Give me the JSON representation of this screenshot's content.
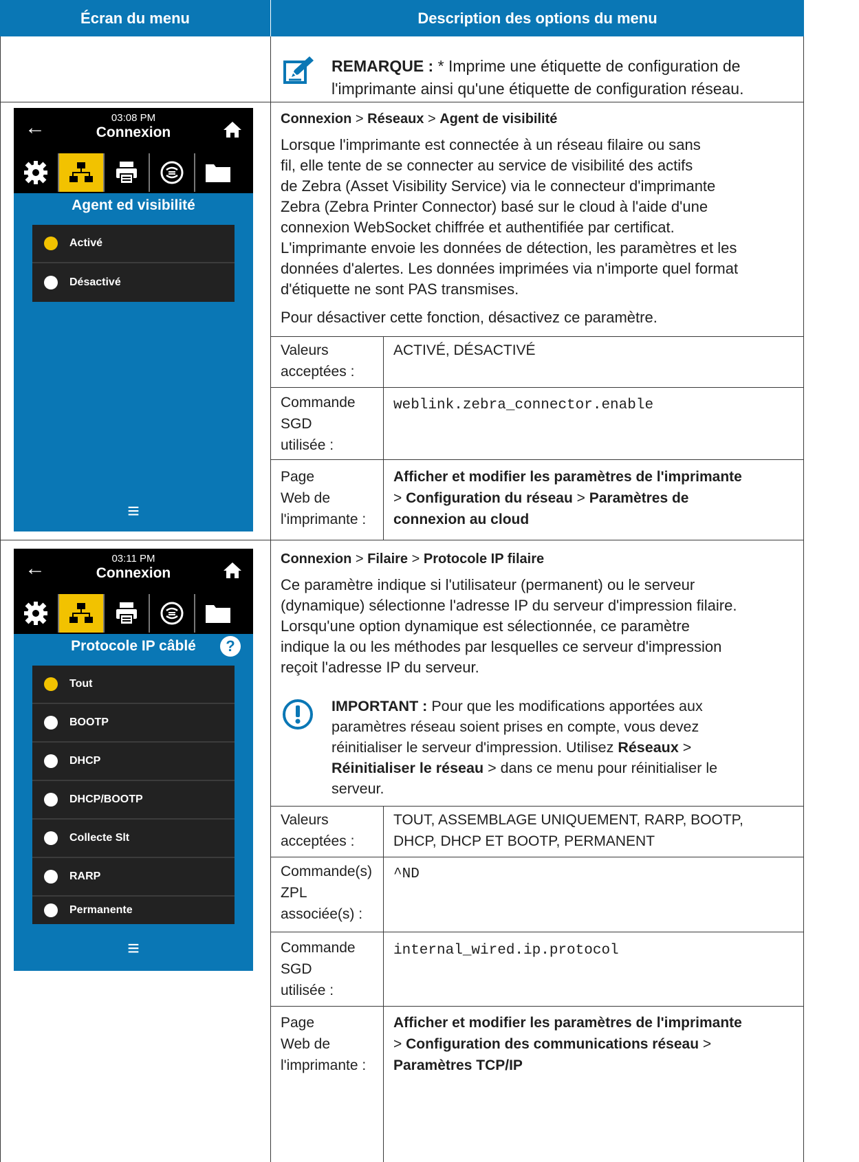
{
  "header": {
    "col1": "Écran du menu",
    "col2": "Description des options du menu"
  },
  "note": {
    "label": "REMARQUE :",
    "text_line1": " * Imprime une étiquette de configuration de",
    "text_line2": "l'imprimante ainsi qu'une étiquette de configuration réseau."
  },
  "section1": {
    "screen": {
      "time": "03:08 PM",
      "title": "Connexion",
      "heading": "Agent ed visibilité",
      "options": [
        {
          "label": "Activé",
          "selected": true
        },
        {
          "label": "Désactivé",
          "selected": false
        }
      ]
    },
    "breadcrumb": {
      "a": "Connexion",
      "sep1": " > ",
      "b": "Réseaux",
      "sep2": " > ",
      "c": "Agent de visibilité"
    },
    "para1": [
      "Lorsque l'imprimante est connectée à un réseau filaire ou sans",
      "fil, elle tente de se connecter au service de visibilité des actifs",
      "de Zebra (Asset Visibility Service) via le connecteur d'imprimante",
      "Zebra (Zebra Printer Connector) basé sur le cloud à l'aide d'une",
      "connexion WebSocket chiffrée et authentifiée par certificat.",
      "L'imprimante envoie les données de détection, les paramètres et les",
      "données d'alertes. Les données imprimées via n'importe quel format",
      "d'étiquette ne sont PAS transmises."
    ],
    "para2": "Pour désactiver cette fonction, désactivez ce paramètre.",
    "table": {
      "r1_label": [
        "Valeurs",
        "acceptées :"
      ],
      "r1_value": "ACTIVÉ, DÉSACTIVÉ",
      "r2_label": [
        "Commande",
        "SGD",
        "utilisée :"
      ],
      "r2_value": "weblink.zebra_connector.enable",
      "r3_label": [
        "Page",
        "Web de",
        "l'imprimante :"
      ],
      "r3_value_l1": "Afficher et modifier les paramètres de l'imprimante",
      "r3_value_l2a": "> ",
      "r3_value_l2b": "Configuration du réseau",
      "r3_value_l2c": " > ",
      "r3_value_l2d": "Paramètres de",
      "r3_value_l3": "connexion au cloud"
    }
  },
  "section2": {
    "screen": {
      "time": "03:11 PM",
      "title": "Connexion",
      "heading": "Protocole IP câblé",
      "options": [
        {
          "label": "Tout",
          "selected": true
        },
        {
          "label": "BOOTP",
          "selected": false
        },
        {
          "label": "DHCP",
          "selected": false
        },
        {
          "label": "DHCP/BOOTP",
          "selected": false
        },
        {
          "label": "Collecte Slt",
          "selected": false
        },
        {
          "label": "RARP",
          "selected": false
        },
        {
          "label": "Permanente",
          "selected": false
        }
      ]
    },
    "breadcrumb": {
      "a": "Connexion",
      "sep1": " > ",
      "b": "Filaire",
      "sep2": " > ",
      "c": "Protocole IP filaire"
    },
    "para1": [
      "Ce paramètre indique si l'utilisateur (permanent) ou le serveur",
      "(dynamique) sélectionne l'adresse IP du serveur d'impression filaire.",
      "Lorsqu'une option dynamique est sélectionnée, ce paramètre",
      "indique la ou les méthodes par lesquelles ce serveur d'impression",
      "reçoit l'adresse IP du serveur."
    ],
    "important": {
      "label": "IMPORTANT :",
      "l1": " Pour que les modifications apportées aux",
      "l2": "paramètres réseau soient prises en compte, vous devez",
      "l3a": "réinitialiser le serveur d'impression. Utilisez ",
      "l3b": "Réseaux",
      "l3c": " >",
      "l4a": "Réinitialiser le réseau",
      "l4b": " > dans ce menu pour réinitialiser le",
      "l5": "serveur."
    },
    "table": {
      "r1_label": [
        "Valeurs",
        "acceptées :"
      ],
      "r1_value": [
        "TOUT, ASSEMBLAGE UNIQUEMENT, RARP, BOOTP,",
        "DHCP, DHCP ET BOOTP, PERMANENT"
      ],
      "r2_label": [
        "Commande(s)",
        "ZPL",
        "associée(s) :"
      ],
      "r2_value": "^ND",
      "r3_label": [
        "Commande",
        "SGD",
        "utilisée :"
      ],
      "r3_value": "internal_wired.ip.protocol",
      "r4_label": [
        "Page",
        "Web de",
        "l'imprimante :"
      ],
      "r4_value_l1": "Afficher et modifier les paramètres de l'imprimante",
      "r4_value_l2a": "> ",
      "r4_value_l2b": "Configuration des communications réseau",
      "r4_value_l2c": " >",
      "r4_value_l3": "Paramètres TCP/IP"
    }
  }
}
